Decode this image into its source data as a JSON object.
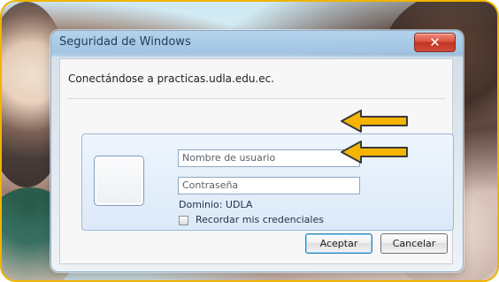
{
  "dialog": {
    "title": "Seguridad de Windows",
    "close_icon": "close-icon",
    "connection_text": "Conectándose a practicas.udla.edu.ec.",
    "username_placeholder": "Nombre de usuario",
    "password_placeholder": "Contraseña",
    "domain_text": "Dominio: UDLA",
    "remember_label": "Recordar mis credenciales",
    "accept_label": "Aceptar",
    "cancel_label": "Cancelar"
  },
  "colors": {
    "frame_border": "#f0b400",
    "arrow_fill": "#f4b400",
    "dialog_titlebar": "#a8cbe8",
    "close_button": "#d84f3a"
  },
  "icons": {
    "user_tile": "user-tile-icon",
    "arrow_pointer": "arrow-pointer-icon"
  }
}
